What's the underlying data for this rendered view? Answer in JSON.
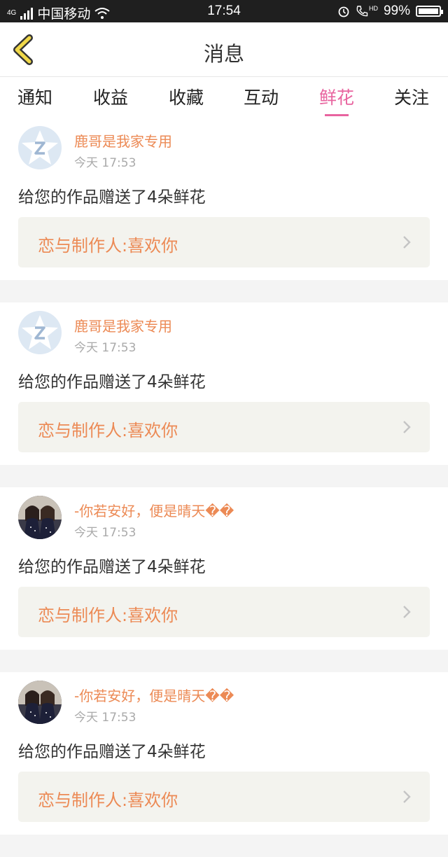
{
  "status_bar": {
    "network_label": "4G",
    "carrier": "中国移动",
    "time": "17:54",
    "hd_label": "HD",
    "battery": "99%"
  },
  "header": {
    "title": "消息"
  },
  "tabs": [
    {
      "label": "通知",
      "active": false
    },
    {
      "label": "收益",
      "active": false
    },
    {
      "label": "收藏",
      "active": false
    },
    {
      "label": "互动",
      "active": false
    },
    {
      "label": "鲜花",
      "active": true
    },
    {
      "label": "关注",
      "active": false
    }
  ],
  "colors": {
    "accent_pink": "#e8649f",
    "name_orange": "#ec8a55"
  },
  "messages": [
    {
      "user": "鹿哥是我家专用",
      "time": "今天 17:53",
      "text": "给您的作品赠送了4朵鲜花",
      "work": "恋与制作人:喜欢你",
      "avatar": "default-avatar-icon"
    },
    {
      "user": "鹿哥是我家专用",
      "time": "今天 17:53",
      "text": "给您的作品赠送了4朵鲜花",
      "work": "恋与制作人:喜欢你",
      "avatar": "default-avatar-icon"
    },
    {
      "user": "-你若安好，便是晴天��",
      "time": "今天 17:53",
      "text": "给您的作品赠送了4朵鲜花",
      "work": "恋与制作人:喜欢你",
      "avatar": "photo-avatar"
    },
    {
      "user": "-你若安好，便是晴天��",
      "time": "今天 17:53",
      "text": "给您的作品赠送了4朵鲜花",
      "work": "恋与制作人:喜欢你",
      "avatar": "photo-avatar"
    }
  ]
}
